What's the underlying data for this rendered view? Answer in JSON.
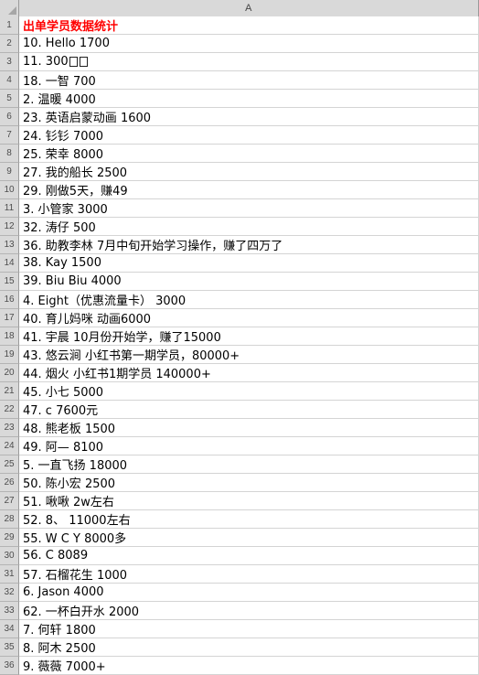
{
  "app": {
    "type": "spreadsheet",
    "select_all_icon": "select-all-triangle"
  },
  "grid": {
    "column_headers": [
      "A"
    ],
    "row_header_numbers": [
      1,
      2,
      3,
      4,
      5,
      6,
      7,
      8,
      9,
      10,
      11,
      12,
      13,
      14,
      15,
      16,
      17,
      18,
      19,
      20,
      21,
      22,
      23,
      24,
      25,
      26,
      27,
      28,
      29,
      30,
      31,
      32,
      33,
      34,
      35,
      36
    ],
    "title_color": "#ff0000",
    "header_fill": "#d9d9d9",
    "gridline_color": "#d4d4d4"
  },
  "rows": [
    {
      "n": "1",
      "a": "出单学员数据统计",
      "style": "title"
    },
    {
      "n": "2",
      "a": "10. Hello 1700",
      "style": "normal"
    },
    {
      "n": "3",
      "a": "11. 300□ □",
      "style": "normal"
    },
    {
      "n": "4",
      "a": "18. 一智 700",
      "style": "normal"
    },
    {
      "n": "5",
      "a": "2. 温暖 4000",
      "style": "normal"
    },
    {
      "n": "6",
      "a": "23. 英语启蒙动画 1600",
      "style": "normal"
    },
    {
      "n": "7",
      "a": "24. 钐钐 7000",
      "style": "normal"
    },
    {
      "n": "8",
      "a": "25. 荣幸 8000",
      "style": "normal"
    },
    {
      "n": "9",
      "a": "27. 我的船长 2500",
      "style": "normal"
    },
    {
      "n": "10",
      "a": "29. 刚做5天，赚49",
      "style": "normal"
    },
    {
      "n": "11",
      "a": "3. 小管家 3000",
      "style": "normal"
    },
    {
      "n": "12",
      "a": "32. 涛仔 500",
      "style": "normal"
    },
    {
      "n": "13",
      "a": "36. 助教李林 7月中旬开始学习操作，赚了四万了",
      "style": "normal"
    },
    {
      "n": "14",
      "a": "38. Kay 1500",
      "style": "normal"
    },
    {
      "n": "15",
      "a": "39. Biu Biu  4000",
      "style": "normal"
    },
    {
      "n": "16",
      "a": "4. Eight（优惠流量卡） 3000",
      "style": "normal"
    },
    {
      "n": "17",
      "a": "40. 育儿妈咪 动画6000",
      "style": "normal"
    },
    {
      "n": "18",
      "a": "41. 宇晨 10月份开始学，赚了15000",
      "style": "normal"
    },
    {
      "n": "19",
      "a": "43. 悠云涧 小红书第一期学员，80000+",
      "style": "normal"
    },
    {
      "n": "20",
      "a": "44. 烟火 小红书1期学员 140000+",
      "style": "normal"
    },
    {
      "n": "21",
      "a": "45. 小七 5000",
      "style": "normal"
    },
    {
      "n": "22",
      "a": "47. c 7600元",
      "style": "normal"
    },
    {
      "n": "23",
      "a": "48. 熊老板 1500",
      "style": "normal"
    },
    {
      "n": "24",
      "a": "49. 阿— 8100",
      "style": "normal"
    },
    {
      "n": "25",
      "a": "5. 一直飞扬 18000",
      "style": "normal"
    },
    {
      "n": "26",
      "a": "50. 陈小宏 2500",
      "style": "normal"
    },
    {
      "n": "27",
      "a": "51. 啾啾 2w左右",
      "style": "normal"
    },
    {
      "n": "28",
      "a": "52. 8、 11000左右",
      "style": "normal"
    },
    {
      "n": "29",
      "a": "55. W C Y 8000多",
      "style": "normal"
    },
    {
      "n": "30",
      "a": "56. C  8089",
      "style": "normal"
    },
    {
      "n": "31",
      "a": "57. 石榴花生 1000",
      "style": "normal"
    },
    {
      "n": "32",
      "a": "6. Jason 4000",
      "style": "normal"
    },
    {
      "n": "33",
      "a": "62. 一杯白开水 2000",
      "style": "normal"
    },
    {
      "n": "34",
      "a": "7. 何轩 1800",
      "style": "normal"
    },
    {
      "n": "35",
      "a": "8. 阿木 2500",
      "style": "normal"
    },
    {
      "n": "36",
      "a": "9. 薇薇 7000+",
      "style": "normal"
    }
  ]
}
